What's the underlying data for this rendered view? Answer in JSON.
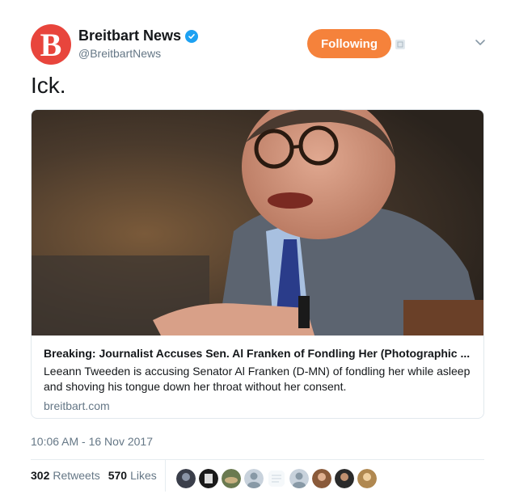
{
  "account": {
    "avatar_letter": "B",
    "display_name": "Breitbart News",
    "handle": "@BreitbartNews",
    "brand_color": "#e8453c",
    "verified_icon": "verified-badge-icon"
  },
  "follow_button": {
    "label": "Following",
    "color": "#f5823b"
  },
  "tweet": {
    "text": "Ick."
  },
  "card": {
    "title": "Breaking: Journalist Accuses Sen. Al Franken of Fondling Her (Photographic ...",
    "description": "Leeann Tweeden is accusing Senator Al Franken (D-MN) of fondling her while asleep and shoving his tongue down her throat without her consent.",
    "domain": "breitbart.com"
  },
  "timestamp": "10:06 AM - 16 Nov 2017",
  "stats": {
    "retweets_count": "302",
    "retweets_label": "Retweets",
    "likes_count": "570",
    "likes_label": "Likes"
  },
  "icons": {
    "menu": "chevron-down-icon",
    "extra": "small-square-icon"
  }
}
